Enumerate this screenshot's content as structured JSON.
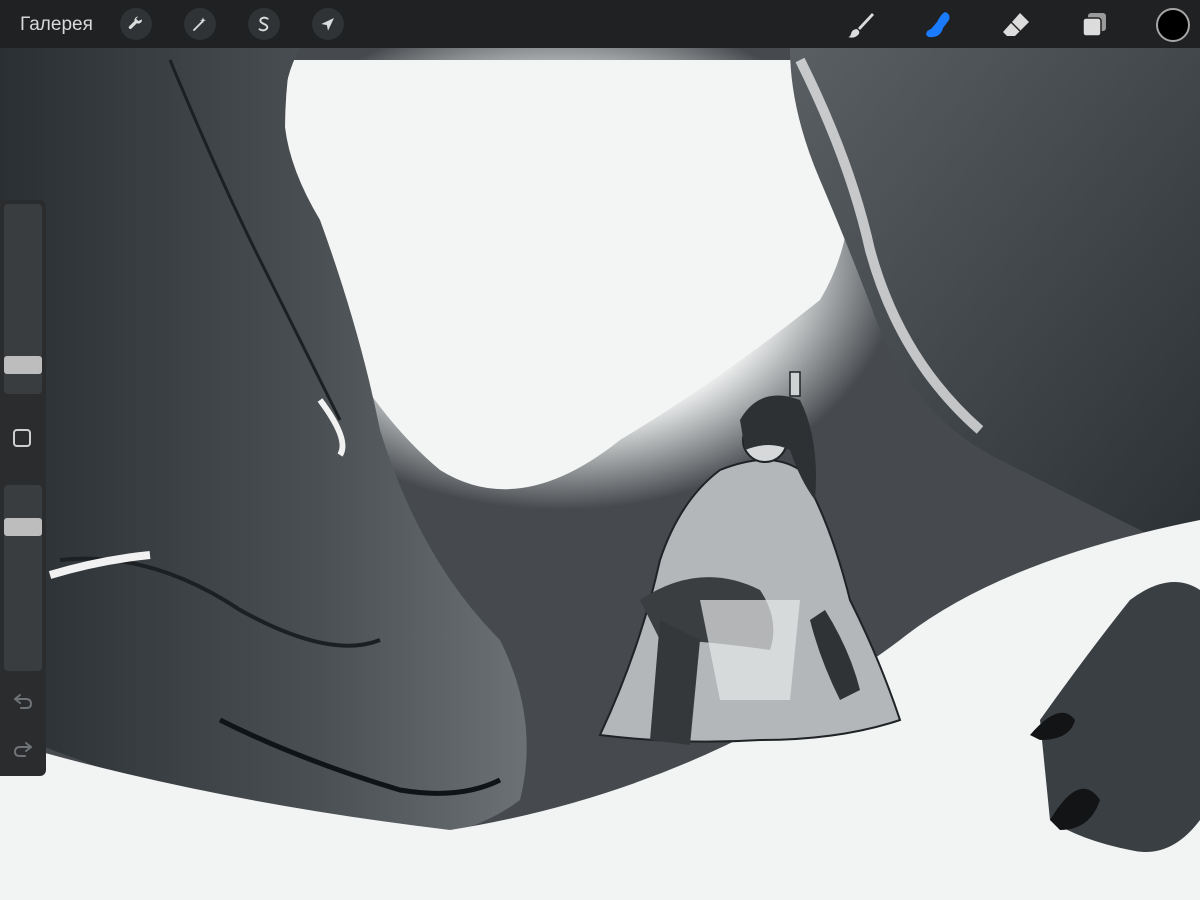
{
  "app": {
    "gallery_label": "Галерея"
  },
  "toolbar": {
    "left_tools": [
      {
        "name": "actions",
        "icon": "wrench-icon"
      },
      {
        "name": "adjustments",
        "icon": "magic-wand-icon"
      },
      {
        "name": "selection",
        "icon": "selection-s-icon"
      },
      {
        "name": "transform",
        "icon": "arrow-cursor-icon"
      }
    ],
    "right_tools": [
      {
        "name": "paint",
        "icon": "brush-icon",
        "active": false
      },
      {
        "name": "smudge",
        "icon": "smudge-finger-icon",
        "active": true
      },
      {
        "name": "erase",
        "icon": "eraser-icon",
        "active": false
      },
      {
        "name": "layers",
        "icon": "layers-icon",
        "active": false
      }
    ],
    "active_color": "#000000",
    "accent_color": "#1a7bff"
  },
  "sidebar": {
    "brush_size_level": 0.25,
    "opacity_level": 0.79
  }
}
